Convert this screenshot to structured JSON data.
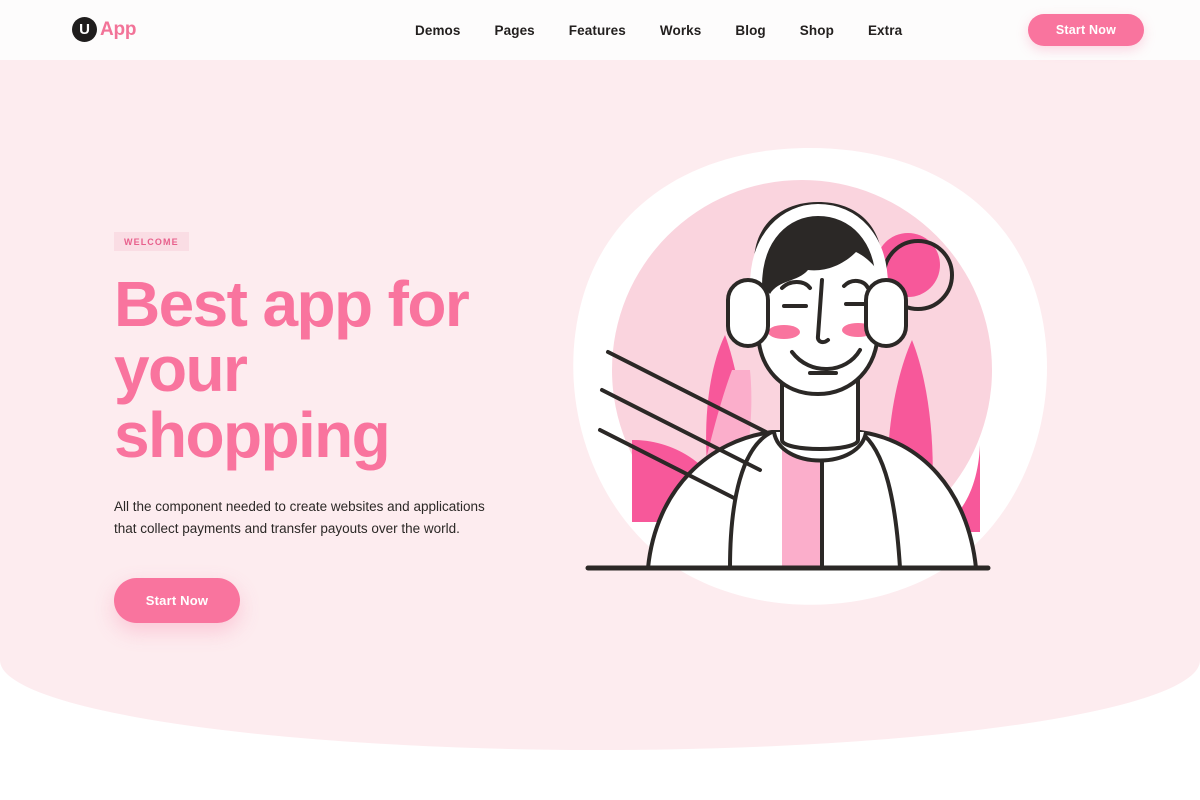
{
  "header": {
    "logo": {
      "mark": "U",
      "text": "App",
      "icon": "circle-u-logo-icon"
    },
    "nav": [
      {
        "label": "Demos"
      },
      {
        "label": "Pages"
      },
      {
        "label": "Features"
      },
      {
        "label": "Works"
      },
      {
        "label": "Blog"
      },
      {
        "label": "Shop"
      },
      {
        "label": "Extra"
      }
    ],
    "cta_label": "Start Now"
  },
  "hero": {
    "badge": "WELCOME",
    "headline_line1": "Best app for",
    "headline_line2": "your shopping",
    "subtext": "All the component needed to create websites and applications that collect payments and transfer payouts over the world.",
    "cta_label": "Start Now"
  },
  "illustration": {
    "name": "person-with-headphones-illustration",
    "elements": [
      "white-blob-background",
      "pink-circle-background",
      "pink-leaf-left",
      "pink-leaf-center",
      "pink-leaf-right",
      "pink-outlined-circle",
      "person-head",
      "person-hair",
      "headphones",
      "person-body-jacket",
      "motion-lines",
      "ground-line"
    ]
  },
  "colors": {
    "page_background": "#ffffff",
    "header_background": "#fdfcfc",
    "hero_background": "#fdecef",
    "accent_pink": "#f9749e",
    "accent_pink_strong": "#f7589a",
    "badge_background": "#fadde4",
    "badge_text": "#e8608c",
    "text_dark": "#23201f",
    "blob_white": "#ffffff",
    "circle_light_pink": "#fad4de",
    "leaf_pink": "#f7589a",
    "leaf_pink_light": "#fbaecb",
    "line_dark": "#2b2826",
    "hair_dark": "#2b2826",
    "cheek_pink": "#f9749e"
  }
}
